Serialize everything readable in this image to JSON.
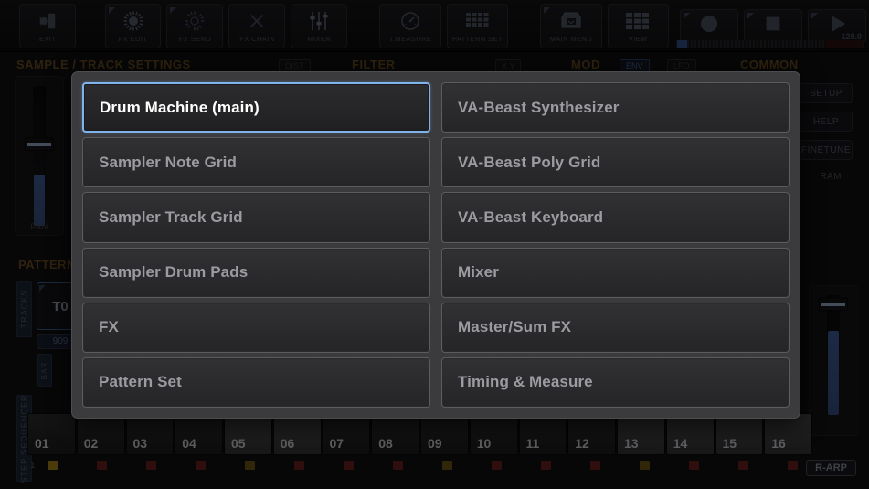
{
  "toolbar": {
    "buttons": [
      {
        "label": "EXIT",
        "icon": "exit-door-icon",
        "corner": false
      },
      {
        "label": "FX EDIT",
        "icon": "knob-bright-icon",
        "corner": true
      },
      {
        "label": "FX SEND",
        "icon": "knob-dim-icon",
        "corner": true
      },
      {
        "label": "FX CHAIN",
        "icon": "x-cross-icon",
        "corner": false
      },
      {
        "label": "MIXER",
        "icon": "sliders-icon",
        "corner": false
      },
      {
        "label": "T.MEASURE",
        "icon": "gauge-icon",
        "corner": false
      },
      {
        "label": "PATTERN SET",
        "icon": "grid-dense-icon",
        "corner": false
      },
      {
        "label": "MAIN MENU",
        "icon": "inbox-tray-icon",
        "corner": true
      },
      {
        "label": "VIEW",
        "icon": "grid-blocks-icon",
        "corner": false
      }
    ],
    "transport": [
      {
        "name": "record-button",
        "icon": "circle-icon"
      },
      {
        "name": "stop-button",
        "icon": "square-icon"
      },
      {
        "name": "play-button",
        "icon": "triangle-icon"
      }
    ],
    "bpm": "128.0"
  },
  "background": {
    "headers": {
      "sample_track_settings": "SAMPLE / TRACK SETTINGS",
      "filter": "FILTER",
      "mod": "MOD",
      "common": "COMMON",
      "pattern": "PATTERN"
    },
    "tabs": {
      "dist": "DIST",
      "xy": "X Y",
      "env": "ENV",
      "lfo": "LFO"
    },
    "pan_label": "PAN",
    "vertical_tabs": {
      "tracks": "TRACKS",
      "sequencer": "SEQUENCER",
      "step_sequencer": "STEP SEQUENCER",
      "bar": "BAR"
    },
    "track_button": "T0",
    "track_name": "909",
    "side_buttons": [
      "SETUP",
      "HELP",
      "FINETUNE"
    ],
    "side_text": "RAM",
    "rarp": "R-ARP",
    "row_number": "1",
    "steps": [
      "01",
      "02",
      "03",
      "04",
      "05",
      "06",
      "07",
      "08",
      "09",
      "10",
      "11",
      "12",
      "13",
      "14",
      "15",
      "16"
    ],
    "lit_steps": [
      "05",
      "06",
      "13",
      "14",
      "15",
      "16"
    ]
  },
  "dialog": {
    "name": "view-selector-dialog",
    "selected": "Drum Machine (main)",
    "options": [
      {
        "label": "Drum Machine (main)",
        "selected": true
      },
      {
        "label": "VA-Beast Synthesizer",
        "selected": false
      },
      {
        "label": "Sampler Note Grid",
        "selected": false
      },
      {
        "label": "VA-Beast Poly Grid",
        "selected": false
      },
      {
        "label": "Sampler Track Grid",
        "selected": false
      },
      {
        "label": "VA-Beast Keyboard",
        "selected": false
      },
      {
        "label": "Sampler Drum Pads",
        "selected": false
      },
      {
        "label": "Mixer",
        "selected": false
      },
      {
        "label": "FX",
        "selected": false
      },
      {
        "label": "Master/Sum FX",
        "selected": false
      },
      {
        "label": "Pattern Set",
        "selected": false
      },
      {
        "label": "Timing &amp; Measure",
        "selected": false
      }
    ]
  },
  "colors": {
    "accent_blue": "#7fb4ea",
    "section_orange": "#6b4d22",
    "dialog_bg": "#3b3b3d"
  }
}
